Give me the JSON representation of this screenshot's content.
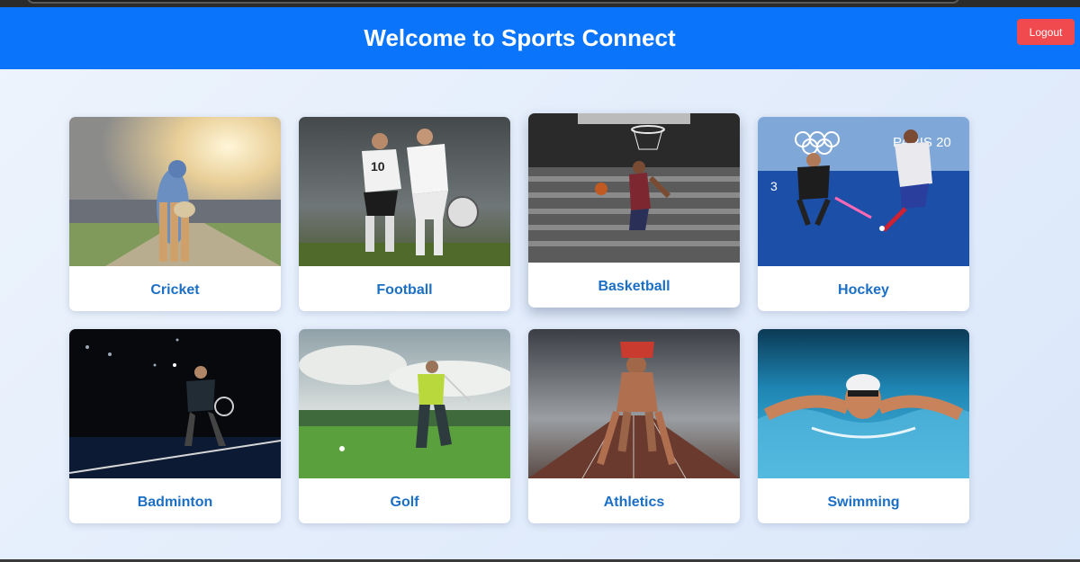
{
  "header": {
    "title": "Welcome to Sports Connect",
    "logout_label": "Logout"
  },
  "cards": [
    {
      "label": "Cricket"
    },
    {
      "label": "Football"
    },
    {
      "label": "Basketball"
    },
    {
      "label": "Hockey"
    },
    {
      "label": "Badminton"
    },
    {
      "label": "Golf"
    },
    {
      "label": "Athletics"
    },
    {
      "label": "Swimming"
    }
  ],
  "hockey_photo_text": "PARIS 20",
  "football_shirt_number": "10",
  "hockey_shirt_number": "3",
  "colors": {
    "header": "#0a74fb",
    "logout": "#f04a4f",
    "card_label": "#1b6fc4"
  }
}
